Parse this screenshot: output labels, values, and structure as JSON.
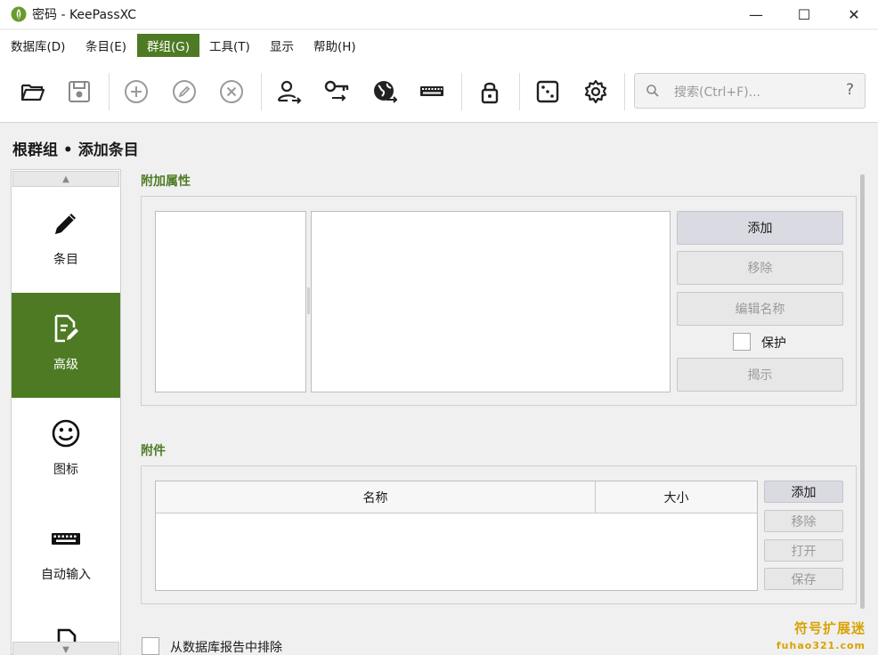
{
  "window": {
    "title": "密码 - KeePassXC",
    "minimize": "—",
    "maximize": "☐",
    "close": "✕"
  },
  "menu": [
    "数据库(D)",
    "条目(E)",
    "群组(G)",
    "工具(T)",
    "显示",
    "帮助(H)"
  ],
  "menu_active_index": 2,
  "toolbar": {
    "icons": [
      "open-database-icon",
      "save-database-icon",
      "add-entry-icon",
      "edit-entry-icon",
      "delete-entry-icon",
      "copy-username-icon",
      "copy-password-icon",
      "copy-url-icon",
      "autotype-icon",
      "lock-database-icon",
      "password-generator-icon",
      "settings-icon"
    ],
    "search": {
      "placeholder": "搜索(Ctrl+F)...",
      "help": "?"
    }
  },
  "breadcrumb": "根群组 • 添加条目",
  "categories": {
    "items": [
      {
        "label": "条目",
        "icon": "pencil-icon"
      },
      {
        "label": "高级",
        "icon": "advanced-document-icon"
      },
      {
        "label": "图标",
        "icon": "smiley-icon"
      },
      {
        "label": "自动输入",
        "icon": "keyboard-icon"
      }
    ],
    "selected_index": 1
  },
  "attributes": {
    "title": "附加属性",
    "add": "添加",
    "remove": "移除",
    "rename": "编辑名称",
    "protect_label": "保护",
    "protect_checked": false,
    "reveal": "揭示"
  },
  "attachments": {
    "title": "附件",
    "columns": [
      "名称",
      "大小"
    ],
    "rows": [],
    "add": "添加",
    "remove": "移除",
    "open": "打开",
    "save": "保存"
  },
  "exclude_from_reports": {
    "label": "从数据库报告中排除",
    "checked": false
  },
  "watermark": {
    "text": "符号扩展迷",
    "sub": "fuhao321.com"
  },
  "colors": {
    "accent": "#4e7a24",
    "window_bg": "#f0f0f0"
  }
}
